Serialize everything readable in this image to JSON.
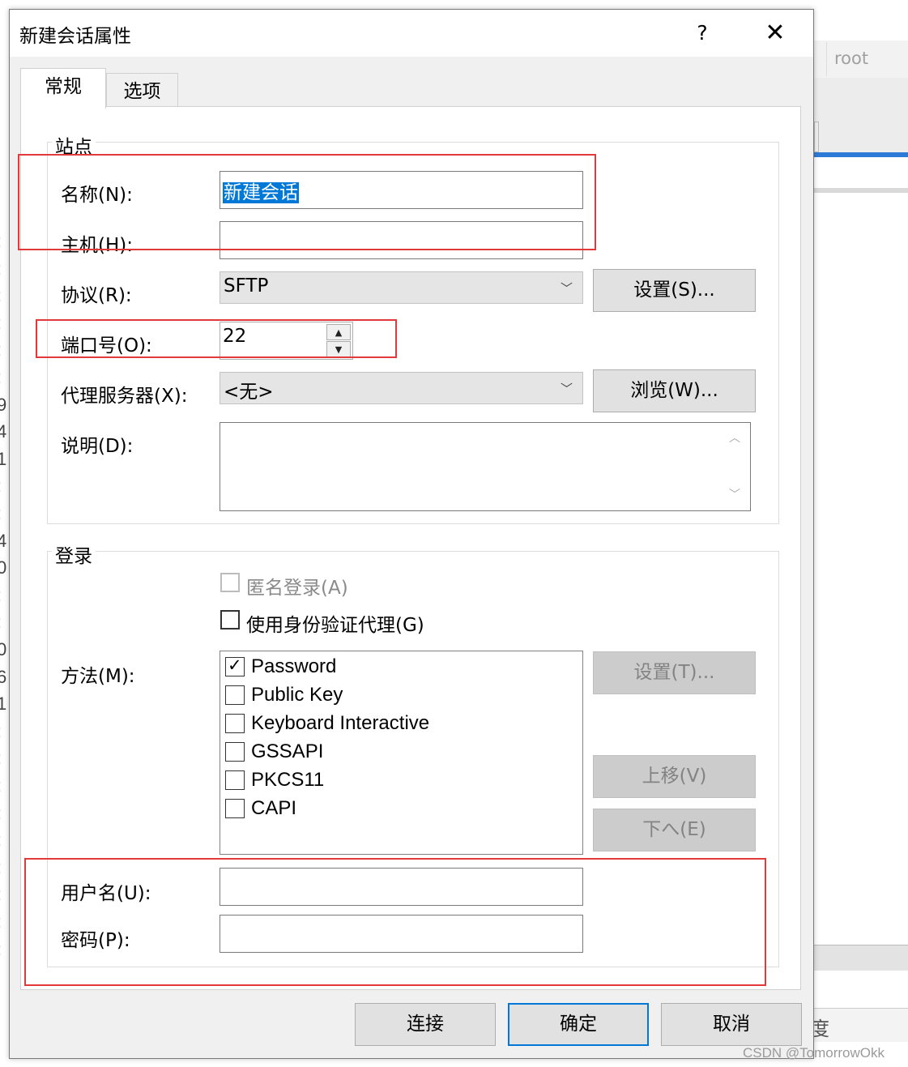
{
  "background": {
    "root_text": "root",
    "status_char": "度",
    "left_marks": [
      ":",
      ":",
      ":",
      ":",
      ":",
      ":",
      "9",
      "4",
      "1",
      ":",
      ":",
      "4",
      "0",
      ":",
      ":",
      "0",
      "6",
      "1",
      ":",
      ":",
      ":",
      ":",
      ":",
      ":",
      ":",
      ":",
      ":"
    ]
  },
  "dialog": {
    "title": "新建会话属性",
    "help_label": "?",
    "close_label": "✕",
    "tabs": [
      {
        "label": "常规",
        "active": true
      },
      {
        "label": "选项",
        "active": false
      }
    ],
    "site_group": {
      "title": "站点",
      "name_label": "名称(N):",
      "name_value": "新建会话",
      "host_label": "主机(H):",
      "host_value": "",
      "protocol_label": "协议(R):",
      "protocol_value": "SFTP",
      "protocol_settings_button": "设置(S)...",
      "port_label": "端口号(O):",
      "port_value": "22",
      "proxy_label": "代理服务器(X):",
      "proxy_value": "<无>",
      "browse_button": "浏览(W)...",
      "description_label": "说明(D):",
      "description_value": ""
    },
    "login_group": {
      "title": "登录",
      "anonymous_label": "匿名登录(A)",
      "anonymous_checked": false,
      "agent_label": "使用身份验证代理(G)",
      "agent_checked": false,
      "method_label": "方法(M):",
      "methods": [
        {
          "label": "Password",
          "checked": true
        },
        {
          "label": "Public Key",
          "checked": false
        },
        {
          "label": "Keyboard Interactive",
          "checked": false
        },
        {
          "label": "GSSAPI",
          "checked": false
        },
        {
          "label": "PKCS11",
          "checked": false
        },
        {
          "label": "CAPI",
          "checked": false
        }
      ],
      "method_settings_button": "设置(T)...",
      "move_up_button": "上移(V)",
      "move_down_button": "下へ(E)",
      "username_label": "用户名(U):",
      "username_value": "",
      "password_label": "密码(P):",
      "password_value": ""
    },
    "footer": {
      "connect_button": "连接",
      "ok_button": "确定",
      "cancel_button": "取消"
    }
  },
  "watermark": "CSDN @TomorrowOkk",
  "colors": {
    "highlight_red": "#e23a3a",
    "selection_blue": "#0078d7",
    "dialog_bg": "#f0f0f0"
  }
}
